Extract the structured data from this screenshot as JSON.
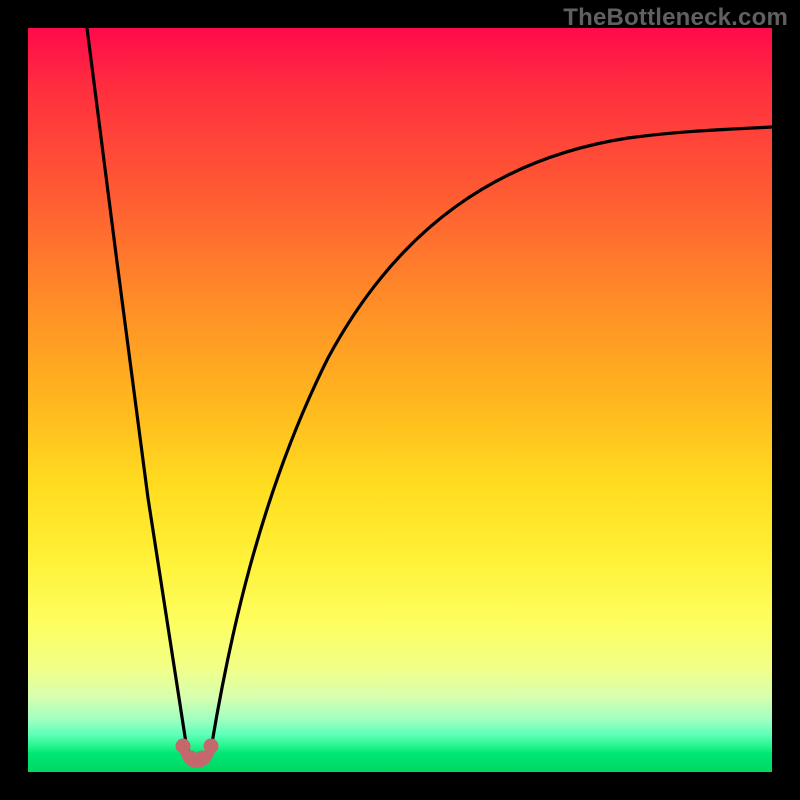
{
  "watermark": "TheBottleneck.com",
  "colors": {
    "frame": "#000000",
    "gradient_top": "#ff0a4a",
    "gradient_mid": "#ffde20",
    "gradient_bottom": "#00d860",
    "curve": "#000000",
    "markers": "#c4686e"
  },
  "chart_data": {
    "type": "line",
    "title": "",
    "xlabel": "",
    "ylabel": "",
    "xlim": [
      0,
      100
    ],
    "ylim": [
      0,
      100
    ],
    "grid": false,
    "legend": false,
    "series": [
      {
        "name": "left-branch",
        "x": [
          8,
          10,
          12,
          14,
          16,
          18,
          19.5,
          20.5,
          21.3
        ],
        "y": [
          100,
          80,
          58,
          40,
          25,
          12,
          5,
          2,
          1
        ]
      },
      {
        "name": "right-branch",
        "x": [
          24.5,
          26,
          28,
          32,
          38,
          46,
          56,
          68,
          82,
          100
        ],
        "y": [
          1,
          5,
          14,
          30,
          46,
          59,
          69,
          77,
          83,
          87
        ]
      },
      {
        "name": "valley-markers",
        "x": [
          20.7,
          21.8,
          23.3,
          24.6
        ],
        "y": [
          1.8,
          0.8,
          0.8,
          1.8
        ]
      }
    ],
    "annotations": [
      {
        "text": "TheBottleneck.com",
        "position": "top-right"
      }
    ]
  }
}
